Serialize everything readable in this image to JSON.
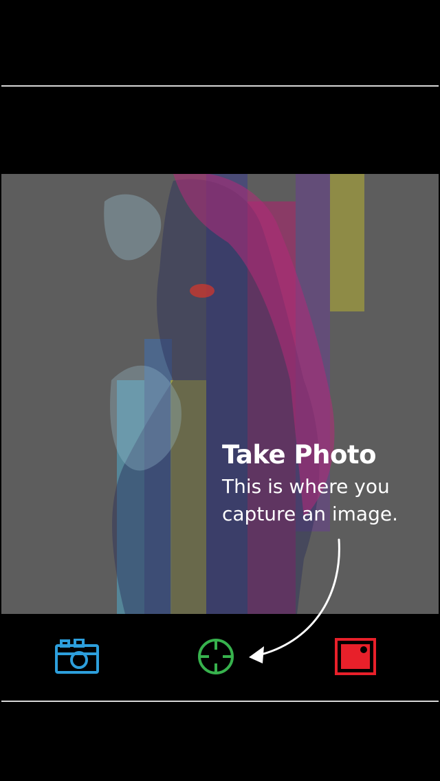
{
  "tooltip": {
    "title": "Take Photo",
    "body": "This is where you capture an image."
  },
  "toolbar": {
    "camera_icon": "camera-icon",
    "capture_icon": "crosshair-icon",
    "gallery_icon": "photo-gallery-icon"
  },
  "colors": {
    "background": "#000000",
    "overlay": "#5d5d5d",
    "camera_blue": "#2d9fdc",
    "capture_green": "#37b24d",
    "gallery_red": "#e8202a",
    "text": "#ffffff"
  }
}
